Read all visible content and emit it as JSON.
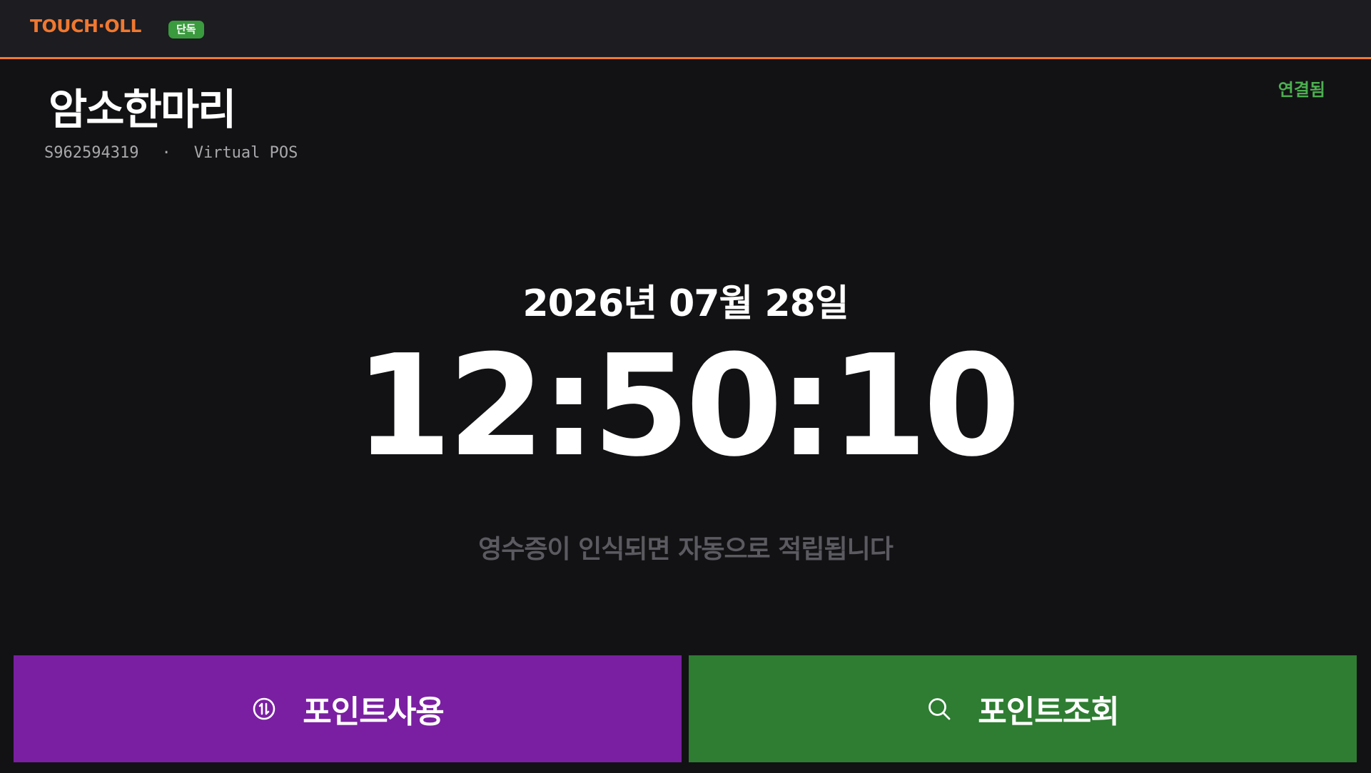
{
  "header": {
    "brand": "TOUCH·OLL",
    "mode_badge": "단독",
    "brand_color": "#f07830",
    "badge_color": "#3a9a3e"
  },
  "store": {
    "name": "암소한마리",
    "id": "S962594319",
    "separator": "·",
    "pos_type": "Virtual POS"
  },
  "connection": {
    "status": "연결됨",
    "color": "#4caf50"
  },
  "clock": {
    "date": "2026년 07월 28일",
    "time": "12:50:10"
  },
  "hint": "영수증이 인식되면 자동으로 적립됩니다",
  "actions": {
    "use_points": {
      "label": "포인트사용",
      "icon": "points-exchange-icon",
      "color": "#7a1fa2"
    },
    "check_points": {
      "label": "포인트조회",
      "icon": "search-icon",
      "color": "#2e7d32"
    }
  }
}
